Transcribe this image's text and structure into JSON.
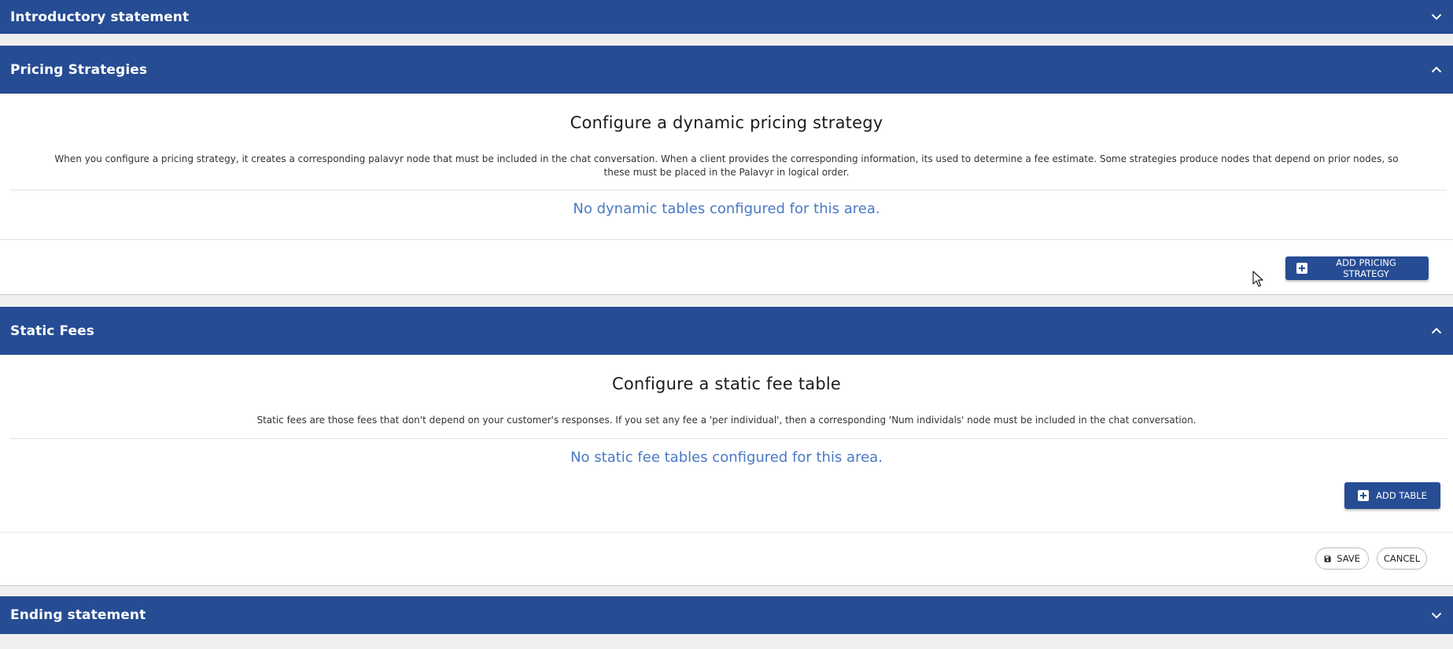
{
  "sections": {
    "intro": {
      "title": "Introductory statement",
      "expanded": false
    },
    "pricing": {
      "title": "Pricing Strategies",
      "expanded": true,
      "heading": "Configure a dynamic pricing strategy",
      "description": "When you configure a pricing strategy, it creates a corresponding palavyr node that must be included in the chat conversation. When a client provides the corresponding information, its used to determine a fee estimate. Some strategies produce nodes that depend on prior nodes, so these must be placed in the Palavyr in logical order.",
      "empty_message": "No dynamic tables configured for this area.",
      "add_label": "ADD PRICING STRATEGY"
    },
    "static": {
      "title": "Static Fees",
      "expanded": true,
      "heading": "Configure a static fee table",
      "description": "Static fees are those fees that don't depend on your customer's responses. If you set any fee a 'per individual', then a corresponding 'Num individals' node must be included in the chat conversation.",
      "empty_message": "No static fee tables configured for this area.",
      "add_label": "ADD TABLE",
      "save_label": "SAVE",
      "cancel_label": "CANCEL"
    },
    "ending": {
      "title": "Ending statement",
      "expanded": false
    }
  },
  "colors": {
    "header_bg": "#264c94",
    "empty_text": "#4a79c4",
    "page_bg": "#efefef"
  },
  "icons": {
    "collapse": "chevron-up-icon",
    "expand": "chevron-down-icon",
    "add": "plus-square-icon",
    "save": "floppy-disk-icon",
    "cursor": "mouse-pointer-icon"
  }
}
